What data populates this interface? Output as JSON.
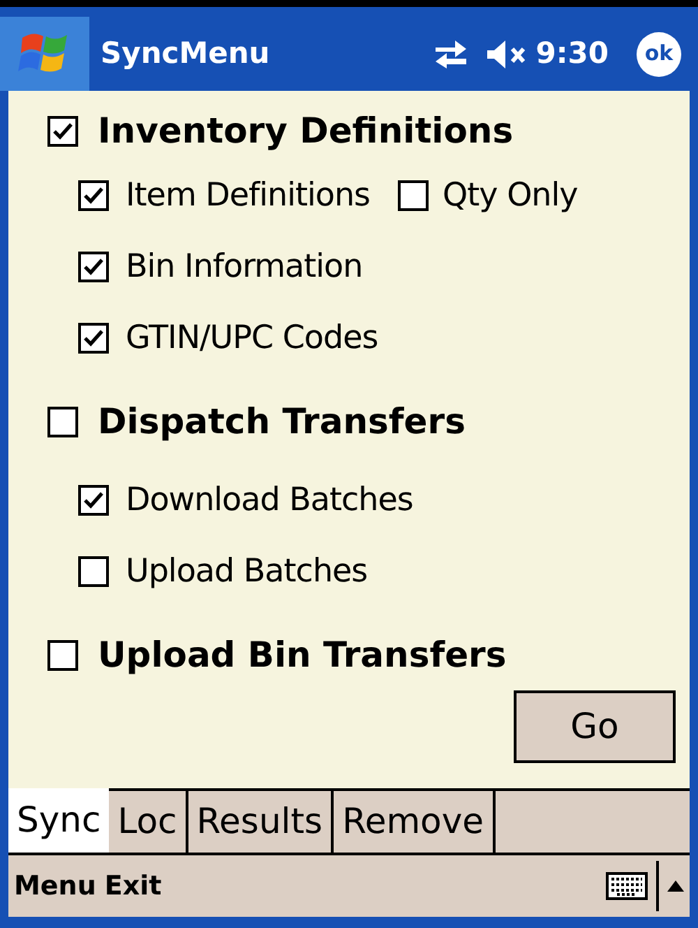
{
  "window": {
    "title": "SyncMenu",
    "time": "9:30",
    "ok_button": "ok"
  },
  "sections": [
    {
      "label": "Inventory Definitions",
      "checked": true,
      "options": [
        {
          "label": "Item Definitions",
          "checked": true,
          "extra": {
            "label": "Qty Only",
            "checked": false
          }
        },
        {
          "label": "Bin Information",
          "checked": true
        },
        {
          "label": "GTIN/UPC Codes",
          "checked": true
        }
      ]
    },
    {
      "label": "Dispatch Transfers",
      "checked": false,
      "options": [
        {
          "label": "Download Batches",
          "checked": true
        },
        {
          "label": "Upload Batches",
          "checked": false
        }
      ]
    },
    {
      "label": "Upload Bin Transfers",
      "checked": false
    }
  ],
  "go_button": "Go",
  "tabs": [
    {
      "label": "Sync",
      "selected": true
    },
    {
      "label": "Loc",
      "selected": false
    },
    {
      "label": "Results",
      "selected": false
    },
    {
      "label": "Remove",
      "selected": false
    }
  ],
  "menu_bar": [
    "Menu",
    "Exit"
  ]
}
